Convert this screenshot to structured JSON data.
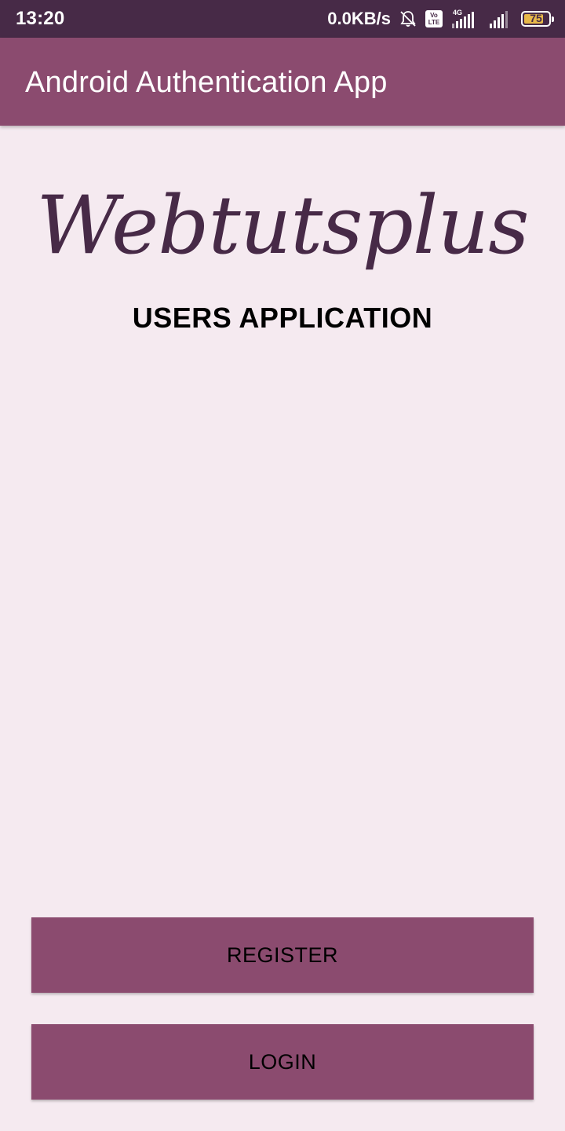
{
  "status_bar": {
    "time": "13:20",
    "net_speed": "0.0KB/s",
    "volte_top": "Vo",
    "volte_bottom": "LTE",
    "network_type": "4G",
    "battery_level": "75",
    "icons": [
      "bell-off-icon",
      "volte-icon",
      "signal-4g-icon",
      "signal-icon",
      "battery-icon"
    ]
  },
  "app_bar": {
    "title": "Android Authentication App"
  },
  "main": {
    "logo_text": "Webtutsplus",
    "subtitle": "USERS APPLICATION"
  },
  "buttons": {
    "register_label": "REGISTER",
    "login_label": "LOGIN"
  },
  "colors": {
    "status_bar": "#472a47",
    "primary": "#8b4b6f",
    "background": "#f5eaf0",
    "logo": "#472a47",
    "battery_fill": "#e7b84a"
  }
}
